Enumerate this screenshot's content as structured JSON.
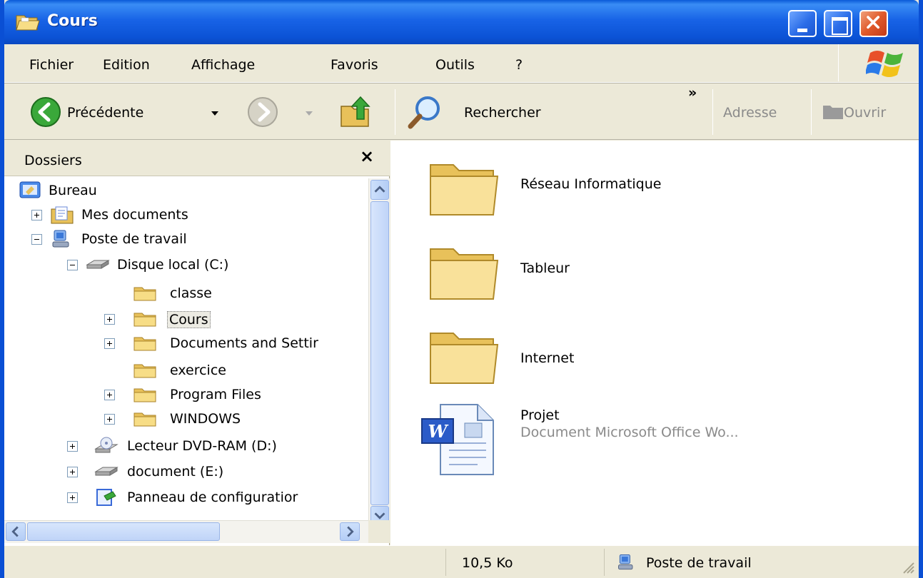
{
  "window": {
    "title": "Cours",
    "accent": "#0a4fd4"
  },
  "menu": {
    "items": [
      "Fichier",
      "Edition",
      "Affichage",
      "Favoris",
      "Outils",
      "?"
    ]
  },
  "toolbar": {
    "back_label": "Précédente",
    "search_label": "Rechercher",
    "overflow": "»",
    "address_label": "Adresse",
    "open_label": "Ouvrir"
  },
  "folders_pane": {
    "title": "Dossiers",
    "close": "×",
    "tree": [
      {
        "label": "Bureau",
        "icon": "desktop-icon"
      },
      {
        "label": "Mes documents",
        "icon": "my-documents-icon"
      },
      {
        "label": "Poste de travail",
        "icon": "my-computer-icon"
      },
      {
        "label": "Disque local (C:)",
        "icon": "hard-drive-icon"
      },
      {
        "label": "classe",
        "icon": "folder-icon"
      },
      {
        "label": "Cours",
        "icon": "folder-icon",
        "selected": true
      },
      {
        "label": "Documents and Settir",
        "icon": "folder-icon"
      },
      {
        "label": "exercice",
        "icon": "folder-icon"
      },
      {
        "label": "Program Files",
        "icon": "folder-icon"
      },
      {
        "label": "WINDOWS",
        "icon": "folder-icon"
      },
      {
        "label": "Lecteur DVD-RAM (D:)",
        "icon": "dvd-drive-icon"
      },
      {
        "label": "document (E:)",
        "icon": "hard-drive-icon"
      },
      {
        "label": "Panneau de configuratior",
        "icon": "control-panel-icon"
      }
    ]
  },
  "content": {
    "items": [
      {
        "name": "Réseau Informatique",
        "type": "folder"
      },
      {
        "name": "Tableur",
        "type": "folder"
      },
      {
        "name": "Internet",
        "type": "folder"
      },
      {
        "name": "Projet",
        "type": "word-document",
        "description": "Document Microsoft Office Wo..."
      }
    ]
  },
  "statusbar": {
    "size": "10,5 Ko",
    "location": "Poste de travail"
  }
}
